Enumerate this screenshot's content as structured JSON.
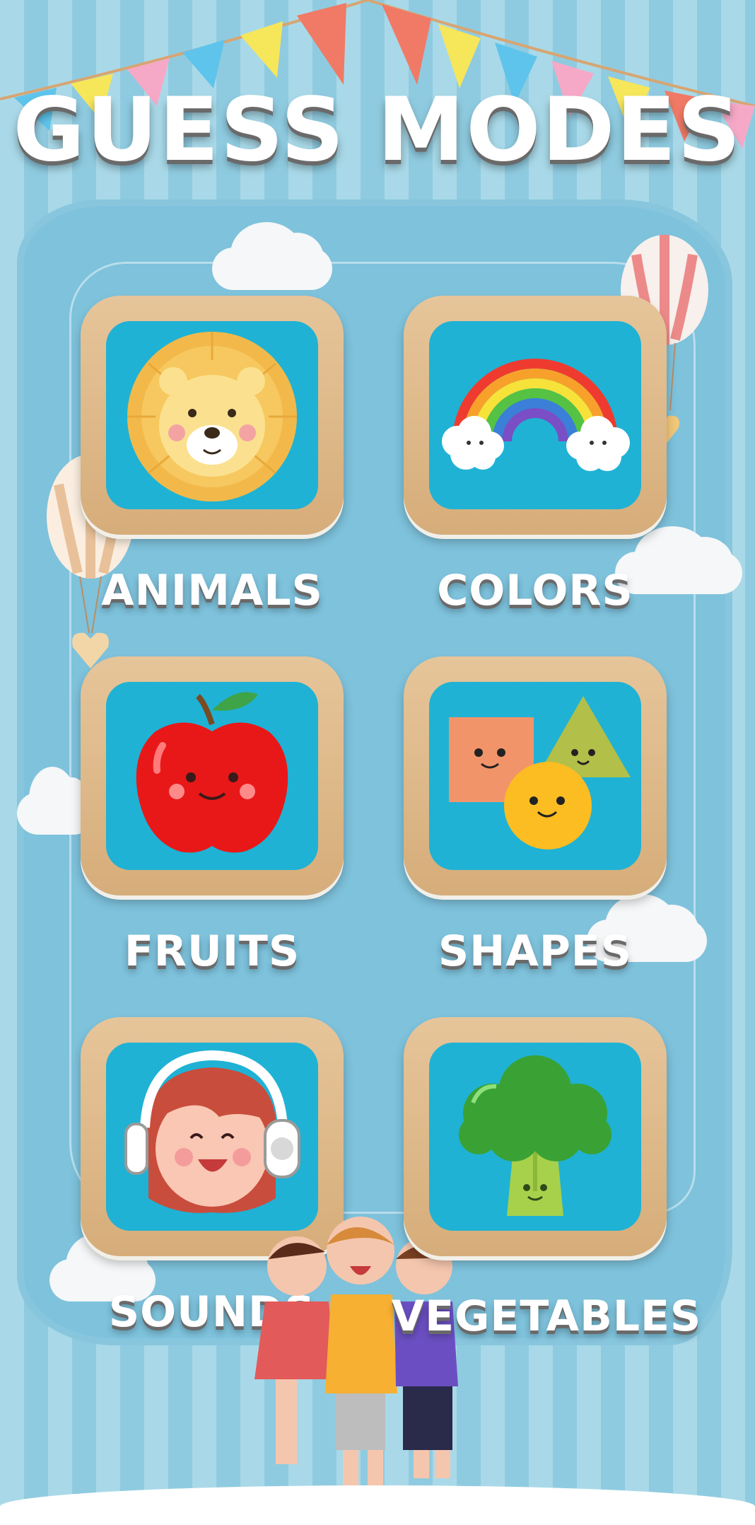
{
  "screen": {
    "title": "GUESS MODES"
  },
  "modes": [
    {
      "label": "ANIMALS",
      "icon": "lion-icon"
    },
    {
      "label": "COLORS",
      "icon": "rainbow-icon"
    },
    {
      "label": "FRUITS",
      "icon": "apple-icon"
    },
    {
      "label": "SHAPES",
      "icon": "shapes-icon"
    },
    {
      "label": "SOUNDS",
      "icon": "headphones-girl-icon"
    },
    {
      "label": "VEGETABLES",
      "icon": "broccoli-icon"
    }
  ],
  "colors": {
    "background_stripe_light": "#a9d9e8",
    "background_stripe_dark": "#8fcbe0",
    "card_frame": "#e0bb8a",
    "card_tile": "#1fb2d4",
    "label_text": "#ffffff"
  }
}
